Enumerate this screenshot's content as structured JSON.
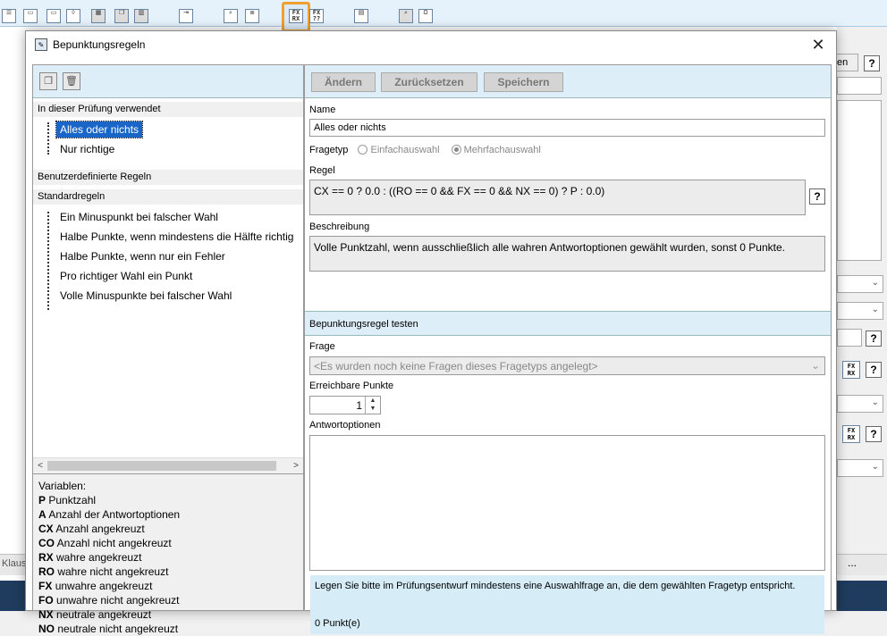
{
  "dialog": {
    "title": "Bepunktungsregeln",
    "close_glyph": "✕"
  },
  "toolbar_icons": [
    "list-icon",
    "window-icon",
    "window-edit-icon",
    "shield-window-icon",
    "grid-icon",
    "copy-icon",
    "delete-icon",
    "import-icon",
    "preview-icon",
    "checklist-icon",
    "fx-rules-icon",
    "fx-question-icon",
    "calculator-icon",
    "search-doc-icon",
    "omega-icon"
  ],
  "left": {
    "section_used": "In dieser Prüfung verwendet",
    "used_rules": [
      "Alles oder nichts",
      "Nur richtige"
    ],
    "section_custom": "Benutzerdefinierte Regeln",
    "section_standard": "Standardregeln",
    "standard_rules": [
      "Ein Minuspunkt bei falscher Wahl",
      "Halbe Punkte, wenn mindestens die Hälfte richtig",
      "Halbe Punkte, wenn nur ein Fehler",
      "Pro richtiger Wahl ein Punkt",
      "Volle Minuspunkte bei falscher Wahl"
    ],
    "variables_title": "Variablen:",
    "variables": [
      {
        "key": "P",
        "desc": "Punktzahl"
      },
      {
        "key": "A",
        "desc": "Anzahl der Antwortoptionen"
      },
      {
        "key": "CX",
        "desc": "Anzahl angekreuzt"
      },
      {
        "key": "CO",
        "desc": "Anzahl nicht angekreuzt"
      },
      {
        "key": "RX",
        "desc": "wahre angekreuzt"
      },
      {
        "key": "RO",
        "desc": "wahre nicht angekreuzt"
      },
      {
        "key": "FX",
        "desc": "unwahre angekreuzt"
      },
      {
        "key": "FO",
        "desc": "unwahre nicht angekreuzt"
      },
      {
        "key": "NX",
        "desc": "neutrale angekreuzt"
      },
      {
        "key": "NO",
        "desc": "neutrale nicht angekreuzt"
      }
    ]
  },
  "right": {
    "btn_change": "Ändern",
    "btn_reset": "Zurücksetzen",
    "btn_save": "Speichern",
    "name_label": "Name",
    "name_value": "Alles oder nichts",
    "type_label": "Fragetyp",
    "type_single": "Einfachauswahl",
    "type_multi": "Mehrfachauswahl",
    "rule_label": "Regel",
    "rule_value": "CX == 0 ? 0.0 : ((RO == 0 && FX == 0 && NX == 0) ? P : 0.0)",
    "help": "?",
    "desc_label": "Beschreibung",
    "desc_value": "Volle Punktzahl, wenn ausschließlich alle wahren Antwortoptionen gewählt wurden, sonst 0 Punkte.",
    "test_header": "Bepunktungsregel testen",
    "question_label": "Frage",
    "question_placeholder": "<Es wurden noch keine Fragen dieses Fragetyps angelegt>",
    "points_label": "Erreichbare Punkte",
    "points_value": "1",
    "options_label": "Antwortoptionen",
    "message": "Legen Sie bitte im Prüfungsentwurf mindestens eine Auswahlfrage an, die dem gewählten Fragetyp entspricht.",
    "result": "0 Punkt(e)"
  },
  "background": {
    "status_left": "Klaus",
    "status_right": "...",
    "right_button_fragment": "en",
    "help": "?"
  }
}
